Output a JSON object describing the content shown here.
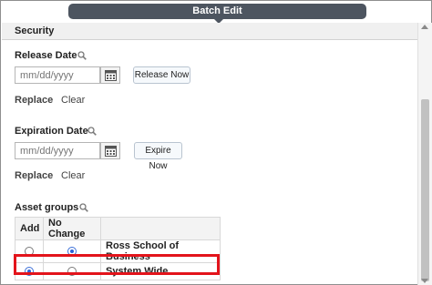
{
  "dialog": {
    "title": "Batch Edit",
    "section": "Security"
  },
  "release": {
    "label": "Release Date",
    "date_placeholder": "mm/dd/yyyy",
    "button": "Release Now",
    "replace": "Replace",
    "clear": "Clear"
  },
  "expiration": {
    "label": "Expiration Date",
    "date_placeholder": "mm/dd/yyyy",
    "button": "Expire Now",
    "replace": "Replace",
    "clear": "Clear"
  },
  "asset_groups": {
    "label": "Asset groups",
    "headers": [
      "Add",
      "No Change",
      ""
    ],
    "rows": [
      {
        "name": "Ross School of Business",
        "add": false,
        "no_change": true
      },
      {
        "name": "System Wide",
        "add": true,
        "no_change": false
      }
    ]
  },
  "colors": {
    "title_bar": "#4d5560",
    "highlight": "#e3141b",
    "radio_selected": "#2a62d8"
  },
  "icons": {
    "search": "magnifier-icon",
    "calendar": "calendar-icon"
  }
}
